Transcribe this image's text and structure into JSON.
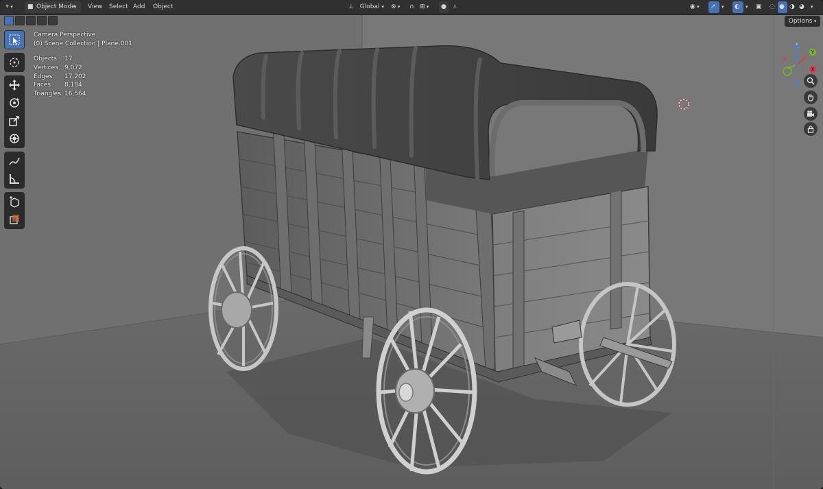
{
  "header": {
    "editor_type_icon": "cube-editor-icon",
    "mode": "Object Mode",
    "menus": [
      "View",
      "Select",
      "Add",
      "Object"
    ],
    "transform_orientation": "Global",
    "pivot_icon": "pivot-icon",
    "snap_icon": "magnet-icon",
    "proportional_icon": "proportional-editing-icon"
  },
  "viewport": {
    "options_label": "Options",
    "overlay": {
      "view_name": "Camera Perspective",
      "collection_line": "(0) Scene Collection | Plane.001"
    },
    "stats": [
      {
        "label": "Objects",
        "value": "17"
      },
      {
        "label": "Vertices",
        "value": "9,072"
      },
      {
        "label": "Edges",
        "value": "17,202"
      },
      {
        "label": "Faces",
        "value": "8,184"
      },
      {
        "label": "Triangles",
        "value": "16,564"
      }
    ],
    "gizmo_axes": {
      "x": "X",
      "y": "Y",
      "z": "Z"
    },
    "colors": {
      "x_axis": "#e0394d",
      "y_axis": "#7bb62a",
      "z_axis": "#3d84e0",
      "accent": "#4772b3"
    }
  },
  "tools": [
    "select-box",
    "cursor",
    "move",
    "rotate",
    "scale",
    "transform",
    "annotate",
    "measure",
    "add-cube",
    "add-object"
  ]
}
